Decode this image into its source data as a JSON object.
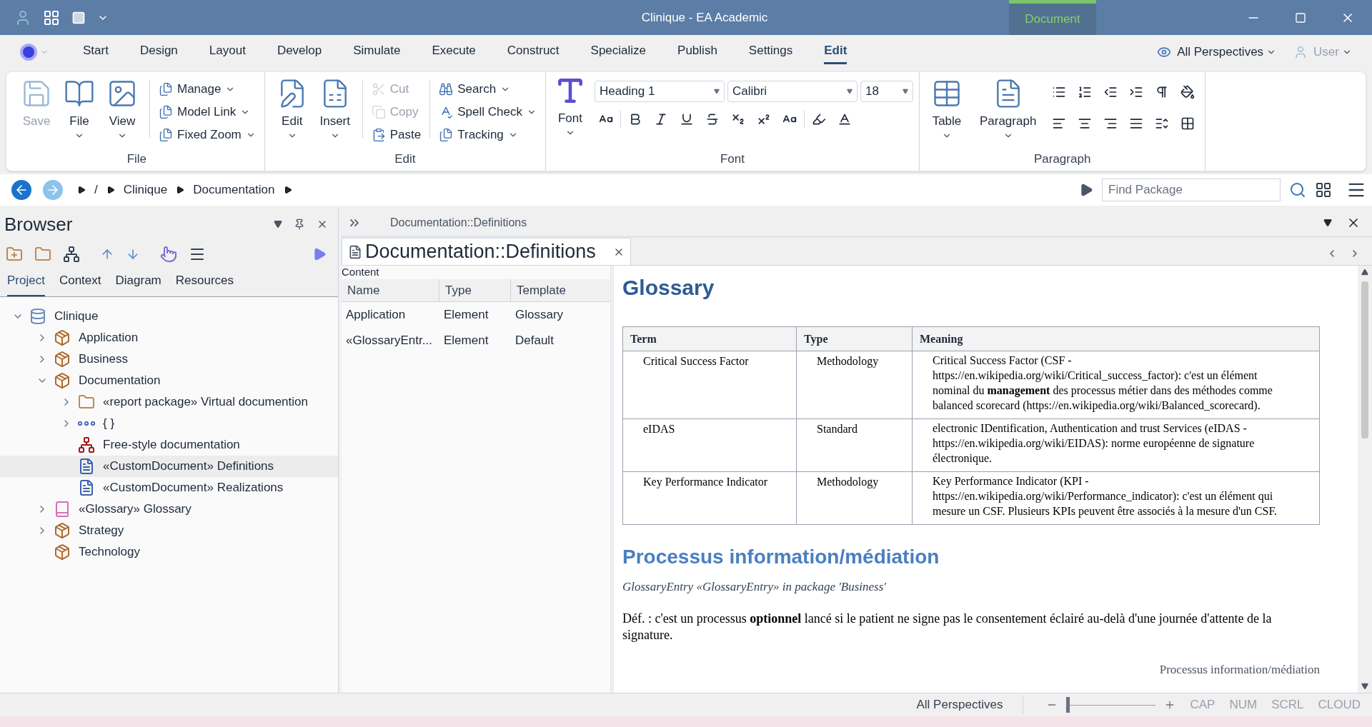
{
  "window": {
    "title": "Clinique - EA Academic",
    "context_tab": "Document"
  },
  "ribbon_tabs": [
    {
      "label": "Start",
      "selected": false
    },
    {
      "label": "Design",
      "selected": false
    },
    {
      "label": "Layout",
      "selected": false
    },
    {
      "label": "Develop",
      "selected": false
    },
    {
      "label": "Simulate",
      "selected": false
    },
    {
      "label": "Execute",
      "selected": false
    },
    {
      "label": "Construct",
      "selected": false
    },
    {
      "label": "Specialize",
      "selected": false
    },
    {
      "label": "Publish",
      "selected": false
    },
    {
      "label": "Settings",
      "selected": false
    },
    {
      "label": "Edit",
      "selected": true
    }
  ],
  "perspective": "All Perspectives",
  "user": "User",
  "ribbon": {
    "file_group": {
      "label": "File",
      "large": [
        {
          "kind": "save",
          "label": "Save",
          "disabled": true
        },
        {
          "kind": "book",
          "label": "File",
          "disabled": false
        },
        {
          "kind": "view",
          "label": "View",
          "disabled": false
        }
      ],
      "small": [
        {
          "label": "Manage",
          "disabled": false
        },
        {
          "label": "Model Link",
          "disabled": false
        },
        {
          "label": "Fixed Zoom",
          "disabled": false
        }
      ]
    },
    "edit_group": {
      "label": "Edit",
      "large": [
        {
          "kind": "edit",
          "label": "Edit",
          "disabled": false
        },
        {
          "kind": "insert",
          "label": "Insert",
          "disabled": false
        }
      ],
      "clipboard": [
        {
          "kind": "cut",
          "label": "Cut",
          "disabled": true
        },
        {
          "kind": "copy",
          "label": "Copy",
          "disabled": true
        },
        {
          "kind": "paste",
          "label": "Paste",
          "disabled": false
        }
      ],
      "tools": [
        {
          "kind": "search",
          "label": "Search",
          "disabled": false
        },
        {
          "kind": "spell",
          "label": "Spell Check",
          "disabled": false
        },
        {
          "kind": "doc",
          "label": "Tracking",
          "disabled": false
        }
      ]
    },
    "font_group": {
      "label": "Font",
      "button": "Font",
      "style": "Heading 1",
      "family": "Calibri",
      "size": "18"
    },
    "paragraph_group": {
      "label": "Paragraph",
      "large": [
        {
          "kind": "table",
          "label": "Table"
        },
        {
          "kind": "paragraph",
          "label": "Paragraph"
        }
      ]
    }
  },
  "breadcrumb": [
    "/",
    "Clinique",
    "Documentation"
  ],
  "find": {
    "placeholder": "Find Package"
  },
  "browser": {
    "title": "Browser",
    "tabs": [
      {
        "label": "Project",
        "selected": true
      },
      {
        "label": "Context",
        "selected": false
      },
      {
        "label": "Diagram",
        "selected": false
      },
      {
        "label": "Resources",
        "selected": false
      }
    ],
    "tree": [
      {
        "label": "Clinique",
        "kind": "model",
        "expanded": true,
        "selected": false,
        "children": [
          {
            "label": "Application",
            "kind": "package",
            "expanded": false,
            "selected": false
          },
          {
            "label": "Business",
            "kind": "package",
            "expanded": false,
            "selected": false
          },
          {
            "label": "Documentation",
            "kind": "package",
            "expanded": true,
            "selected": false,
            "children": [
              {
                "label": "«report package» Virtual documention",
                "kind": "folder",
                "expanded": false,
                "selected": false
              },
              {
                "label": "{ }",
                "kind": "dots",
                "expanded": false,
                "selected": false
              },
              {
                "label": "Free-style documentation",
                "kind": "hierarchy",
                "selected": false
              },
              {
                "label": "«CustomDocument» Definitions",
                "kind": "document",
                "selected": true
              },
              {
                "label": "«CustomDocument» Realizations",
                "kind": "document",
                "selected": false
              }
            ]
          },
          {
            "label": "«Glossary» Glossary",
            "kind": "glossary",
            "expanded": false,
            "selected": false
          },
          {
            "label": "Strategy",
            "kind": "package",
            "expanded": false,
            "selected": false
          },
          {
            "label": "Technology",
            "kind": "package",
            "selected": false
          }
        ]
      }
    ]
  },
  "document_view": {
    "header": "Documentation::Definitions",
    "tab": "Documentation::Definitions",
    "content_label": "Content",
    "columns": [
      "Name",
      "Type",
      "Template"
    ],
    "rows": [
      [
        "Application",
        "Element",
        "Glossary"
      ],
      [
        "«GlossaryEntr...",
        "Element",
        "Default"
      ]
    ]
  },
  "document": {
    "heading": "Glossary",
    "table": {
      "columns": [
        "Term",
        "Type",
        "Meaning"
      ],
      "rows": [
        {
          "term": "Critical Success Factor",
          "type": "Methodology",
          "meaning": "Critical Success Factor (CSF - https://en.wikipedia.org/wiki/Critical_success_factor): c'est un élément nominal du **management** des processus métier dans des méthodes comme balanced scorecard (https://en.wikipedia.org/wiki/Balanced_scorecard)."
        },
        {
          "term": "eIDAS",
          "type": "Standard",
          "meaning": "electronic IDentification, Authentication and trust Services (eIDAS - https://en.wikipedia.org/wiki/EIDAS): norme européenne de signature électronique."
        },
        {
          "term": "Key Performance Indicator",
          "type": "Methodology",
          "meaning": "Key Performance Indicator (KPI - https://en.wikipedia.org/wiki/Performance_indicator): c'est un élément qui mesure un CSF. Plusieurs KPIs peuvent être associés à la mesure d'un CSF."
        }
      ]
    },
    "section_heading": "Processus information/médiation",
    "section_subtitle": "GlossaryEntry «GlossaryEntry» in package 'Business'",
    "section_text": "Déf. : c'est un processus **optionnel** lancé si le patient ne signe pas le consentement éclairé au-delà d'une journée d'attente de la signature.",
    "page_footer": "Processus information/médiation"
  },
  "status_bar": {
    "perspective": "All Perspectives",
    "zoom": {
      "level": 0
    },
    "indicators": [
      {
        "label": "CAP",
        "on": false
      },
      {
        "label": "NUM",
        "on": false
      },
      {
        "label": "SCRL",
        "on": false
      },
      {
        "label": "CLOUD",
        "on": false
      }
    ]
  }
}
